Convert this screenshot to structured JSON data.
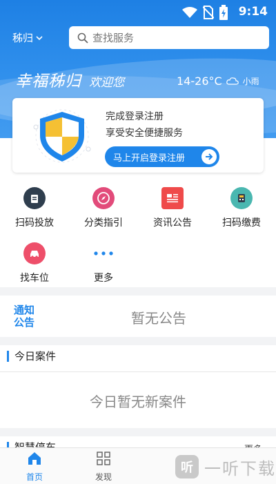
{
  "status_bar": {
    "time": "9:14"
  },
  "header": {
    "city": "秭归",
    "search_placeholder": "查找服务"
  },
  "banner": {
    "slogan": "幸福秭归",
    "welcome": "欢迎您",
    "temperature": "14-26°C",
    "weather": "小雨"
  },
  "login_card": {
    "line1": "完成登录注册",
    "line2": "享受安全便捷服务",
    "button_label": "马上开启登录注册"
  },
  "services": [
    {
      "label": "扫码投放",
      "icon": "trash-bin-icon",
      "color": "#2f3e4e"
    },
    {
      "label": "分类指引",
      "icon": "compass-icon",
      "color": "#e24b7a"
    },
    {
      "label": "资讯公告",
      "icon": "news-icon",
      "color": "#ef4a4a"
    },
    {
      "label": "扫码缴费",
      "icon": "payment-terminal-icon",
      "color": "#4ab7b0"
    },
    {
      "label": "找车位",
      "icon": "car-icon",
      "color": "#ee4f6a"
    },
    {
      "label": "更多",
      "icon": "more-dots-icon",
      "color": "#1f86ea"
    }
  ],
  "notice": {
    "tag_line1": "通知",
    "tag_line2": "公告",
    "empty_text": "暂无公告"
  },
  "cases": {
    "title": "今日案件",
    "empty_text": "今日暂无新案件"
  },
  "smart": {
    "title": "智慧停车",
    "more": "更多"
  },
  "tabbar": {
    "home": "首页",
    "discover": "发现",
    "active_color": "#1f86ea"
  },
  "watermark": {
    "logo_text": "听",
    "text": "一听下载"
  }
}
